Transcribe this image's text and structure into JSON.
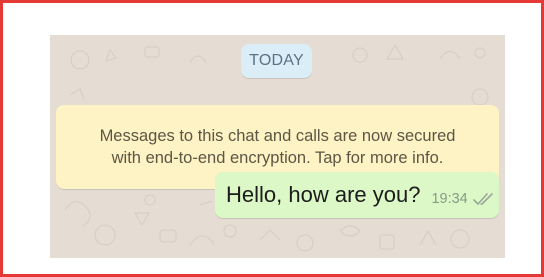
{
  "chat": {
    "date_separator": "TODAY",
    "system_notice": {
      "line1": "Messages to this chat and calls are now secured",
      "line2": "with end-to-end encryption. Tap for more info."
    },
    "messages": [
      {
        "direction": "outgoing",
        "text": "Hello, how are you?",
        "time": "19:34",
        "status_icon": "double-check-icon"
      }
    ]
  },
  "colors": {
    "frame_border": "#e53935",
    "chat_background": "#e5ddd4",
    "date_pill": "#dbeef8",
    "system_notice": "#fdf3c4",
    "outgoing_bubble": "#dcf8c6"
  }
}
